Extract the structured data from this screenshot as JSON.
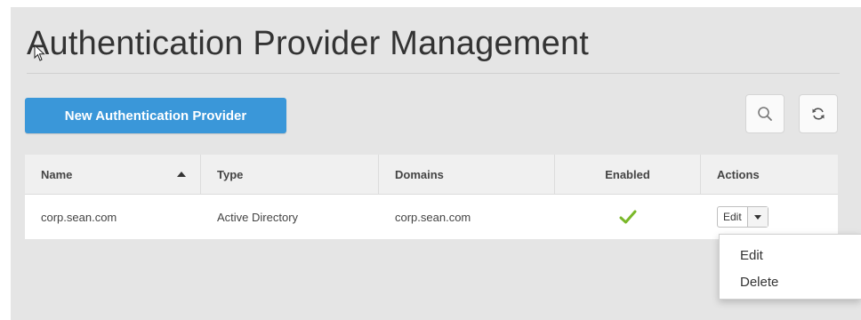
{
  "page": {
    "title": "Authentication Provider Management",
    "accent_color": "#3a97d9"
  },
  "toolbar": {
    "new_button_label": "New Authentication Provider",
    "search_icon": "search-icon",
    "refresh_icon": "refresh-icon"
  },
  "table": {
    "columns": [
      {
        "label": "Name",
        "sorted": "ascending"
      },
      {
        "label": "Type"
      },
      {
        "label": "Domains"
      },
      {
        "label": "Enabled"
      },
      {
        "label": "Actions"
      }
    ],
    "rows": [
      {
        "name": "corp.sean.com",
        "type": "Active Directory",
        "domains": "corp.sean.com",
        "enabled": true,
        "enabled_icon": "checkmark-icon",
        "action_label": "Edit"
      }
    ]
  },
  "actions_menu": {
    "items": [
      "Edit",
      "Delete"
    ]
  }
}
